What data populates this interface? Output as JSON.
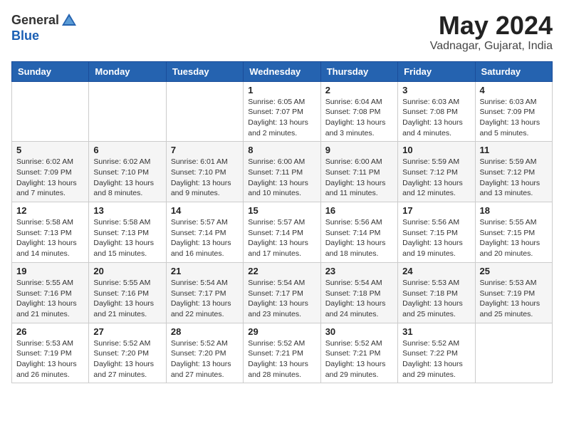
{
  "header": {
    "logo_general": "General",
    "logo_blue": "Blue",
    "month_year": "May 2024",
    "location": "Vadnagar, Gujarat, India"
  },
  "weekdays": [
    "Sunday",
    "Monday",
    "Tuesday",
    "Wednesday",
    "Thursday",
    "Friday",
    "Saturday"
  ],
  "weeks": [
    [
      {
        "day": "",
        "info": ""
      },
      {
        "day": "",
        "info": ""
      },
      {
        "day": "",
        "info": ""
      },
      {
        "day": "1",
        "info": "Sunrise: 6:05 AM\nSunset: 7:07 PM\nDaylight: 13 hours\nand 2 minutes."
      },
      {
        "day": "2",
        "info": "Sunrise: 6:04 AM\nSunset: 7:08 PM\nDaylight: 13 hours\nand 3 minutes."
      },
      {
        "day": "3",
        "info": "Sunrise: 6:03 AM\nSunset: 7:08 PM\nDaylight: 13 hours\nand 4 minutes."
      },
      {
        "day": "4",
        "info": "Sunrise: 6:03 AM\nSunset: 7:09 PM\nDaylight: 13 hours\nand 5 minutes."
      }
    ],
    [
      {
        "day": "5",
        "info": "Sunrise: 6:02 AM\nSunset: 7:09 PM\nDaylight: 13 hours\nand 7 minutes."
      },
      {
        "day": "6",
        "info": "Sunrise: 6:02 AM\nSunset: 7:10 PM\nDaylight: 13 hours\nand 8 minutes."
      },
      {
        "day": "7",
        "info": "Sunrise: 6:01 AM\nSunset: 7:10 PM\nDaylight: 13 hours\nand 9 minutes."
      },
      {
        "day": "8",
        "info": "Sunrise: 6:00 AM\nSunset: 7:11 PM\nDaylight: 13 hours\nand 10 minutes."
      },
      {
        "day": "9",
        "info": "Sunrise: 6:00 AM\nSunset: 7:11 PM\nDaylight: 13 hours\nand 11 minutes."
      },
      {
        "day": "10",
        "info": "Sunrise: 5:59 AM\nSunset: 7:12 PM\nDaylight: 13 hours\nand 12 minutes."
      },
      {
        "day": "11",
        "info": "Sunrise: 5:59 AM\nSunset: 7:12 PM\nDaylight: 13 hours\nand 13 minutes."
      }
    ],
    [
      {
        "day": "12",
        "info": "Sunrise: 5:58 AM\nSunset: 7:13 PM\nDaylight: 13 hours\nand 14 minutes."
      },
      {
        "day": "13",
        "info": "Sunrise: 5:58 AM\nSunset: 7:13 PM\nDaylight: 13 hours\nand 15 minutes."
      },
      {
        "day": "14",
        "info": "Sunrise: 5:57 AM\nSunset: 7:14 PM\nDaylight: 13 hours\nand 16 minutes."
      },
      {
        "day": "15",
        "info": "Sunrise: 5:57 AM\nSunset: 7:14 PM\nDaylight: 13 hours\nand 17 minutes."
      },
      {
        "day": "16",
        "info": "Sunrise: 5:56 AM\nSunset: 7:14 PM\nDaylight: 13 hours\nand 18 minutes."
      },
      {
        "day": "17",
        "info": "Sunrise: 5:56 AM\nSunset: 7:15 PM\nDaylight: 13 hours\nand 19 minutes."
      },
      {
        "day": "18",
        "info": "Sunrise: 5:55 AM\nSunset: 7:15 PM\nDaylight: 13 hours\nand 20 minutes."
      }
    ],
    [
      {
        "day": "19",
        "info": "Sunrise: 5:55 AM\nSunset: 7:16 PM\nDaylight: 13 hours\nand 21 minutes."
      },
      {
        "day": "20",
        "info": "Sunrise: 5:55 AM\nSunset: 7:16 PM\nDaylight: 13 hours\nand 21 minutes."
      },
      {
        "day": "21",
        "info": "Sunrise: 5:54 AM\nSunset: 7:17 PM\nDaylight: 13 hours\nand 22 minutes."
      },
      {
        "day": "22",
        "info": "Sunrise: 5:54 AM\nSunset: 7:17 PM\nDaylight: 13 hours\nand 23 minutes."
      },
      {
        "day": "23",
        "info": "Sunrise: 5:54 AM\nSunset: 7:18 PM\nDaylight: 13 hours\nand 24 minutes."
      },
      {
        "day": "24",
        "info": "Sunrise: 5:53 AM\nSunset: 7:18 PM\nDaylight: 13 hours\nand 25 minutes."
      },
      {
        "day": "25",
        "info": "Sunrise: 5:53 AM\nSunset: 7:19 PM\nDaylight: 13 hours\nand 25 minutes."
      }
    ],
    [
      {
        "day": "26",
        "info": "Sunrise: 5:53 AM\nSunset: 7:19 PM\nDaylight: 13 hours\nand 26 minutes."
      },
      {
        "day": "27",
        "info": "Sunrise: 5:52 AM\nSunset: 7:20 PM\nDaylight: 13 hours\nand 27 minutes."
      },
      {
        "day": "28",
        "info": "Sunrise: 5:52 AM\nSunset: 7:20 PM\nDaylight: 13 hours\nand 27 minutes."
      },
      {
        "day": "29",
        "info": "Sunrise: 5:52 AM\nSunset: 7:21 PM\nDaylight: 13 hours\nand 28 minutes."
      },
      {
        "day": "30",
        "info": "Sunrise: 5:52 AM\nSunset: 7:21 PM\nDaylight: 13 hours\nand 29 minutes."
      },
      {
        "day": "31",
        "info": "Sunrise: 5:52 AM\nSunset: 7:22 PM\nDaylight: 13 hours\nand 29 minutes."
      },
      {
        "day": "",
        "info": ""
      }
    ]
  ]
}
